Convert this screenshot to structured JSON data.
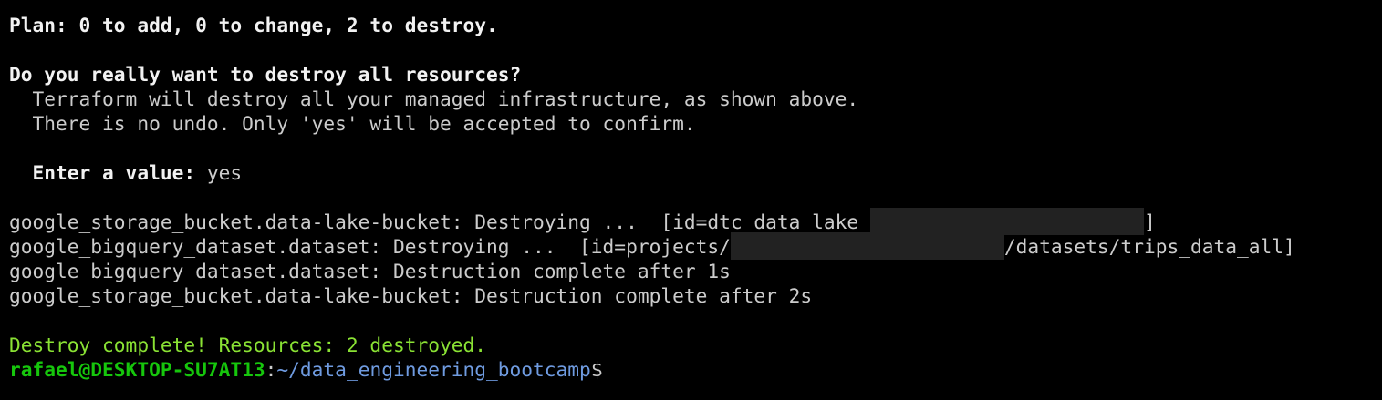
{
  "terminal": {
    "plan_line": "Plan: 0 to add, 0 to change, 2 to destroy.",
    "question": "Do you really want to destroy all resources?",
    "warning_1": "  Terraform will destroy all your managed infrastructure, as shown above.",
    "warning_2": "  There is no undo. Only 'yes' will be accepted to confirm.",
    "enter_value_prompt": "  Enter a value: ",
    "entered_value": "yes",
    "log": [
      {
        "prefix": "google_storage_bucket.data-lake-bucket: Destroying ...  [id=dtc_data_lake_",
        "suffix": "]"
      },
      {
        "prefix": "google_bigquery_dataset.dataset: Destroying ...  [id=projects/",
        "suffix": "/datasets/trips_data_all]"
      },
      {
        "text": "google_bigquery_dataset.dataset: Destruction complete after 1s"
      },
      {
        "text": "google_storage_bucket.data-lake-bucket: Destruction complete after 2s"
      }
    ],
    "result": "Destroy complete! Resources: 2 destroyed.",
    "prompt_user_host": "rafael@DESKTOP-SU7AT13",
    "prompt_separator": ":",
    "prompt_path": "~/data_engineering_bootcamp",
    "prompt_symbol": "$ "
  },
  "colors": {
    "background": "#000000",
    "text": "#cccccc",
    "bold_text": "#f2f2f2",
    "success_green": "#8ae234",
    "prompt_green": "#16c60c",
    "path_blue": "#6f9be0",
    "redaction": "#222222"
  }
}
